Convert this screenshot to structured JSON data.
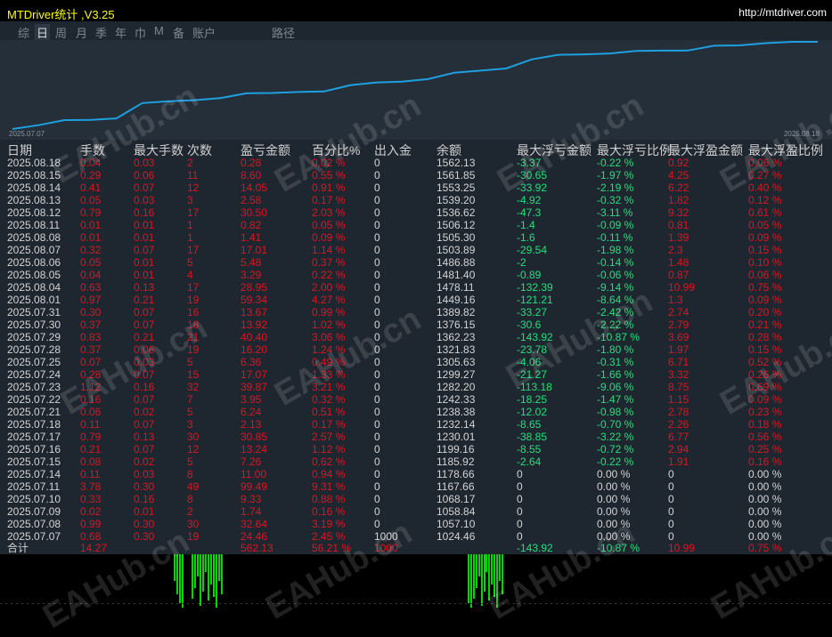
{
  "title": "MTDriver统计 ,V3.25",
  "url": "http://mtdriver.com",
  "tabs": [
    {
      "label": "综",
      "active": false
    },
    {
      "label": "日",
      "active": true
    },
    {
      "label": "周",
      "active": false
    },
    {
      "label": "月",
      "active": false
    },
    {
      "label": "季",
      "active": false
    },
    {
      "label": "年",
      "active": false
    },
    {
      "label": "巾",
      "active": false
    },
    {
      "label": "M",
      "active": false
    },
    {
      "label": "备",
      "active": false
    },
    {
      "label": "账户",
      "active": false
    },
    {
      "label": "路径",
      "active": false
    }
  ],
  "chart": {
    "start_date": "2025.07.07",
    "end_date": "2025.08.18",
    "line_color": "#1ea0e0"
  },
  "columns": [
    "日期",
    "手数",
    "最大手数",
    "次数",
    "盈亏金额",
    "百分比%",
    "出入金",
    "余额",
    "最大浮亏金额",
    "最大浮亏比例",
    "最大浮盈金额",
    "最大浮盈比例"
  ],
  "rows": [
    [
      "2025.08.18",
      "0.04",
      "0.03",
      "2",
      "0.28",
      "0.02 %",
      "0",
      "1562.13",
      "-3.37",
      "-0.22 %",
      "0.92",
      "0.06 %"
    ],
    [
      "2025.08.15",
      "0.29",
      "0.06",
      "11",
      "8.60",
      "0.55 %",
      "0",
      "1561.85",
      "-30.65",
      "-1.97 %",
      "4.25",
      "0.27 %"
    ],
    [
      "2025.08.14",
      "0.41",
      "0.07",
      "12",
      "14.05",
      "0.91 %",
      "0",
      "1553.25",
      "-33.92",
      "-2.19 %",
      "6.22",
      "0.40 %"
    ],
    [
      "2025.08.13",
      "0.05",
      "0.03",
      "3",
      "2.58",
      "0.17 %",
      "0",
      "1539.20",
      "-4.92",
      "-0.32 %",
      "1.82",
      "0.12 %"
    ],
    [
      "2025.08.12",
      "0.79",
      "0.16",
      "17",
      "30.50",
      "2.03 %",
      "0",
      "1536.62",
      "-47.3",
      "-3.11 %",
      "9.32",
      "0.61 %"
    ],
    [
      "2025.08.11",
      "0.01",
      "0.01",
      "1",
      "0.82",
      "0.05 %",
      "0",
      "1506.12",
      "-1.4",
      "-0.09 %",
      "0.81",
      "0.05 %"
    ],
    [
      "2025.08.08",
      "0.01",
      "0.01",
      "1",
      "1.41",
      "0.09 %",
      "0",
      "1505.30",
      "-1.6",
      "-0.11 %",
      "1.39",
      "0.09 %"
    ],
    [
      "2025.08.07",
      "0.32",
      "0.07",
      "17",
      "17.01",
      "1.14 %",
      "0",
      "1503.89",
      "-29.54",
      "-1.98 %",
      "2.3",
      "0.15 %"
    ],
    [
      "2025.08.06",
      "0.05",
      "0.01",
      "5",
      "5.48",
      "0.37 %",
      "0",
      "1486.88",
      "-2",
      "-0.14 %",
      "1.48",
      "0.10 %"
    ],
    [
      "2025.08.05",
      "0.04",
      "0.01",
      "4",
      "3.29",
      "0.22 %",
      "0",
      "1481.40",
      "-0.89",
      "-0.06 %",
      "0.87",
      "0.06 %"
    ],
    [
      "2025.08.04",
      "0.63",
      "0.13",
      "17",
      "28.95",
      "2.00 %",
      "0",
      "1478.11",
      "-132.39",
      "-9.14 %",
      "10.99",
      "0.75 %"
    ],
    [
      "2025.08.01",
      "0.97",
      "0.21",
      "19",
      "59.34",
      "4.27 %",
      "0",
      "1449.16",
      "-121.21",
      "-8.64 %",
      "1.3",
      "0.09 %"
    ],
    [
      "2025.07.31",
      "0.30",
      "0.07",
      "16",
      "13.67",
      "0.99 %",
      "0",
      "1389.82",
      "-33.27",
      "-2.42 %",
      "2.74",
      "0.20 %"
    ],
    [
      "2025.07.30",
      "0.37",
      "0.07",
      "18",
      "13.92",
      "1.02 %",
      "0",
      "1376.15",
      "-30.6",
      "-2.22 %",
      "2.79",
      "0.21 %"
    ],
    [
      "2025.07.29",
      "0.83",
      "0.21",
      "21",
      "40.40",
      "3.06 %",
      "0",
      "1362.23",
      "-143.92",
      "-10.87 %",
      "3.69",
      "0.28 %"
    ],
    [
      "2025.07.28",
      "0.37",
      "0.06",
      "19",
      "16.20",
      "1.24 %",
      "0",
      "1321.83",
      "-23.78",
      "-1.80 %",
      "1.97",
      "0.15 %"
    ],
    [
      "2025.07.25",
      "0.07",
      "0.03",
      "5",
      "6.36",
      "0.49 %",
      "0",
      "1305.63",
      "-4.06",
      "-0.31 %",
      "6.71",
      "0.52 %"
    ],
    [
      "2025.07.24",
      "0.28",
      "0.07",
      "15",
      "17.07",
      "1.33 %",
      "0",
      "1299.27",
      "-21.27",
      "-1.66 %",
      "3.32",
      "0.26 %"
    ],
    [
      "2025.07.23",
      "1.12",
      "0.16",
      "32",
      "39.87",
      "3.21 %",
      "0",
      "1282.20",
      "-113.18",
      "-9.06 %",
      "8.75",
      "0.69 %"
    ],
    [
      "2025.07.22",
      "0.16",
      "0.07",
      "7",
      "3.95",
      "0.32 %",
      "0",
      "1242.33",
      "-18.25",
      "-1.47 %",
      "1.15",
      "0.09 %"
    ],
    [
      "2025.07.21",
      "0.06",
      "0.02",
      "5",
      "6.24",
      "0.51 %",
      "0",
      "1238.38",
      "-12.02",
      "-0.98 %",
      "2.78",
      "0.23 %"
    ],
    [
      "2025.07.18",
      "0.11",
      "0.07",
      "3",
      "2.13",
      "0.17 %",
      "0",
      "1232.14",
      "-8.65",
      "-0.70 %",
      "2.26",
      "0.18 %"
    ],
    [
      "2025.07.17",
      "0.79",
      "0.13",
      "30",
      "30.85",
      "2.57 %",
      "0",
      "1230.01",
      "-38.85",
      "-3.22 %",
      "6.77",
      "0.56 %"
    ],
    [
      "2025.07.16",
      "0.21",
      "0.07",
      "12",
      "13.24",
      "1.12 %",
      "0",
      "1199.16",
      "-8.55",
      "-0.72 %",
      "2.94",
      "0.25 %"
    ],
    [
      "2025.07.15",
      "0.08",
      "0.02",
      "5",
      "7.26",
      "0.62 %",
      "0",
      "1185.92",
      "-2.64",
      "-0.22 %",
      "1.91",
      "0.16 %"
    ],
    [
      "2025.07.14",
      "0.11",
      "0.03",
      "8",
      "11.00",
      "0.94 %",
      "0",
      "1178.66",
      "0",
      "0.00 %",
      "0",
      "0.00 %"
    ],
    [
      "2025.07.11",
      "3.78",
      "0.30",
      "49",
      "99.49",
      "9.31 %",
      "0",
      "1167.66",
      "0",
      "0.00 %",
      "0",
      "0.00 %"
    ],
    [
      "2025.07.10",
      "0.33",
      "0.16",
      "8",
      "9.33",
      "0.88 %",
      "0",
      "1068.17",
      "0",
      "0.00 %",
      "0",
      "0.00 %"
    ],
    [
      "2025.07.09",
      "0.02",
      "0.01",
      "2",
      "1.74",
      "0.16 %",
      "0",
      "1058.84",
      "0",
      "0.00 %",
      "0",
      "0.00 %"
    ],
    [
      "2025.07.08",
      "0.99",
      "0.30",
      "30",
      "32.64",
      "3.19 %",
      "0",
      "1057.10",
      "0",
      "0.00 %",
      "0",
      "0.00 %"
    ],
    [
      "2025.07.07",
      "0.68",
      "0.30",
      "19",
      "24.46",
      "2.45 %",
      "1000",
      "1024.46",
      "0",
      "0.00 %",
      "0",
      "0.00 %"
    ]
  ],
  "total": [
    "合计",
    "14.27",
    "",
    "",
    "562.13",
    "56.21 %",
    "1000",
    "",
    "-143.92",
    "-10.87 %",
    "10.99",
    "0.75 %"
  ],
  "watermark": "EAHub.cn",
  "colors": {
    "positive": "#e0141e",
    "negative": "#22e07a",
    "neutral": "#d4d4d4",
    "title": "#ffff00"
  }
}
